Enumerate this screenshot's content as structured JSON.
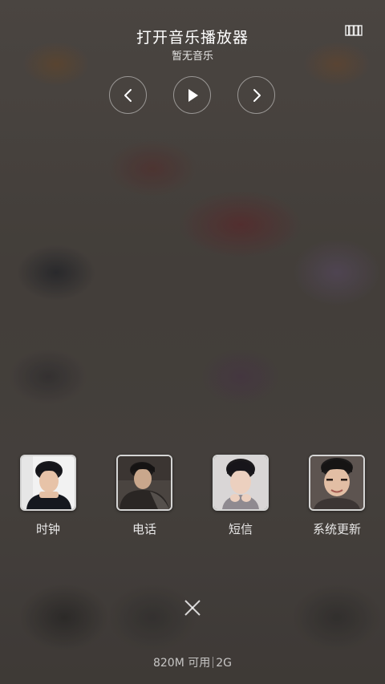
{
  "music": {
    "title": "打开音乐播放器",
    "subtitle": "暂无音乐"
  },
  "controls": {
    "prev_icon": "chevron-left-icon",
    "play_icon": "play-icon",
    "next_icon": "chevron-right-icon",
    "playlist_icon": "playlist-icon"
  },
  "apps": [
    {
      "label": "时钟",
      "icon": "clock-app-avatar"
    },
    {
      "label": "电话",
      "icon": "phone-app-avatar"
    },
    {
      "label": "短信",
      "icon": "sms-app-avatar"
    },
    {
      "label": "系统更新",
      "icon": "system-update-app-avatar"
    }
  ],
  "status": {
    "memory": "820M 可用",
    "network": "2G"
  },
  "colors": {
    "background": "#514a45",
    "text": "#ffffff"
  }
}
